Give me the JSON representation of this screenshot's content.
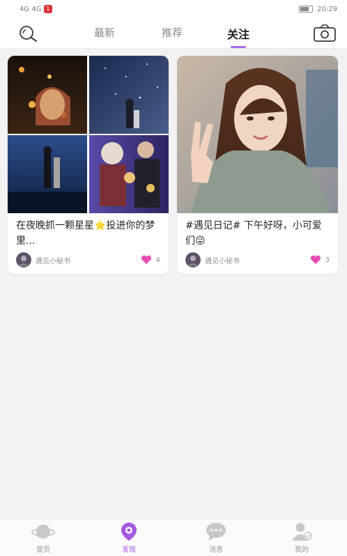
{
  "status_bar": {
    "left_text": "4G 4G",
    "notification_badge": "1",
    "time": "20:29"
  },
  "header": {
    "tabs": [
      {
        "label": "最新",
        "active": false
      },
      {
        "label": "推荐",
        "active": false
      },
      {
        "label": "关注",
        "active": true
      }
    ],
    "search_icon": "search-icon",
    "camera_icon": "camera-icon",
    "accent_color": "#a66ee6"
  },
  "feed": {
    "posts": [
      {
        "title": "在夜晚抓一颗星星⭐投进你的梦里...",
        "author": "遇见小秘书",
        "likes": "4"
      },
      {
        "title": "#遇见日记# 下午好呀，小可爱们😜",
        "author": "遇见小秘书",
        "likes": "3"
      }
    ]
  },
  "bottom_nav": {
    "items": [
      {
        "label": "首页",
        "icon": "planet-icon",
        "active": false
      },
      {
        "label": "发现",
        "icon": "discover-icon",
        "active": true
      },
      {
        "label": "消息",
        "icon": "chat-icon",
        "active": false
      },
      {
        "label": "我的",
        "icon": "profile-icon",
        "active": false
      }
    ],
    "active_color": "#a459e0",
    "inactive_color": "#c8c8c8"
  }
}
